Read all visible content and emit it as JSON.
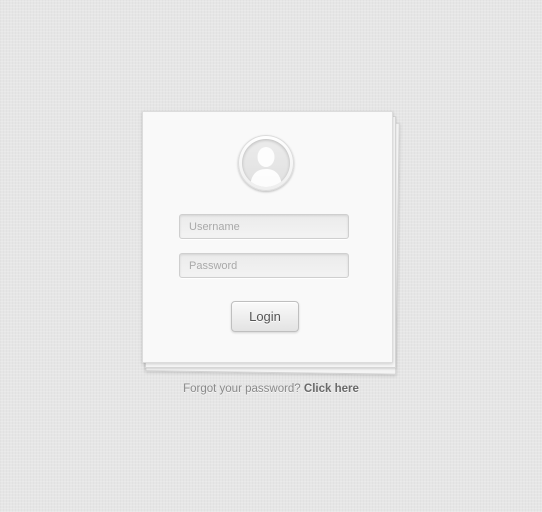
{
  "login_form": {
    "username_placeholder": "Username",
    "password_placeholder": "Password",
    "login_label": "Login"
  },
  "footer": {
    "forgot_text": "Forgot your password?",
    "click_here_label": "Click here"
  },
  "icons": {
    "avatar": "user-silhouette-icon"
  },
  "colors": {
    "background": "#e6e6e6",
    "card": "#f9f9f9",
    "text_muted": "#8a8a8a",
    "link": "#6a6a6a"
  }
}
